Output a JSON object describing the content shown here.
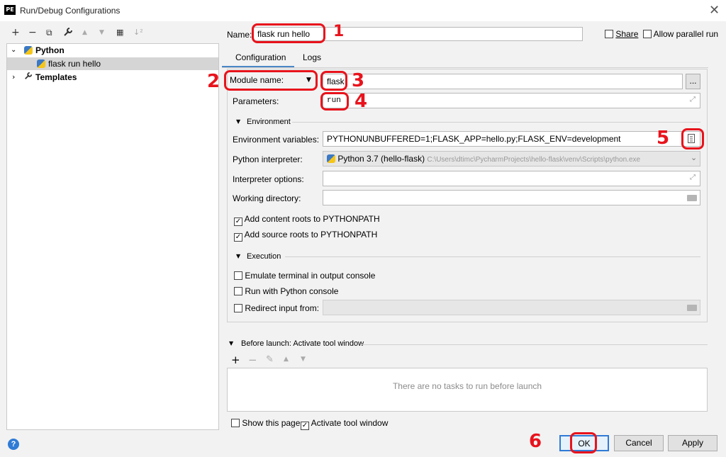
{
  "window": {
    "title": "Run/Debug Configurations",
    "app_icon": "PE",
    "close": "✕"
  },
  "toolbar": {
    "add": "+",
    "remove": "−",
    "copy": "⧉",
    "wrench": "🔧",
    "up": "▲",
    "down": "▼",
    "folder": "▦",
    "sort": "↓²"
  },
  "tree": {
    "python_label": "Python",
    "config_label": "flask run hello",
    "templates_label": "Templates"
  },
  "name_field": {
    "label": "Name:",
    "value": "flask run hello"
  },
  "share": {
    "label": "Share",
    "checked": false
  },
  "allow_parallel": {
    "label": "Allow parallel run",
    "checked": false
  },
  "tabs": [
    "Configuration",
    "Logs"
  ],
  "module": {
    "label": "Module name:",
    "value": "flask",
    "browse": "..."
  },
  "parameters": {
    "label": "Parameters:",
    "value": "run"
  },
  "environment": {
    "section": "Environment",
    "env_vars_label": "Environment variables:",
    "env_vars_value": "PYTHONUNBUFFERED=1;FLASK_APP=hello.py;FLASK_ENV=development",
    "interpreter_label": "Python interpreter:",
    "interpreter_name": "Python 3.7 (hello-flask)",
    "interpreter_path": "C:\\Users\\dtimc\\PycharmProjects\\hello-flask\\venv\\Scripts\\python.exe",
    "interp_options_label": "Interpreter options:",
    "working_dir_label": "Working directory:",
    "content_roots": "Add content roots to PYTHONPATH",
    "source_roots": "Add source roots to PYTHONPATH"
  },
  "execution": {
    "section": "Execution",
    "emulate": "Emulate terminal in output console",
    "python_console": "Run with Python console",
    "redirect": "Redirect input from:"
  },
  "before_launch": {
    "section": "Before launch: Activate tool window",
    "empty": "There are no tasks to run before launch",
    "add": "+",
    "remove": "−",
    "edit": "✎",
    "up": "▲",
    "down": "▼"
  },
  "footer": {
    "show_page": "Show this page",
    "activate_tool": "Activate tool window",
    "help": "?",
    "ok": "OK",
    "cancel": "Cancel",
    "apply": "Apply"
  },
  "annotations": {
    "n1": "1",
    "n2": "2",
    "n3": "3",
    "n4": "4",
    "n5": "5",
    "n6": "6"
  },
  "colors": {
    "accent": "#4a88c7",
    "annotation_red": "#e8131c"
  }
}
